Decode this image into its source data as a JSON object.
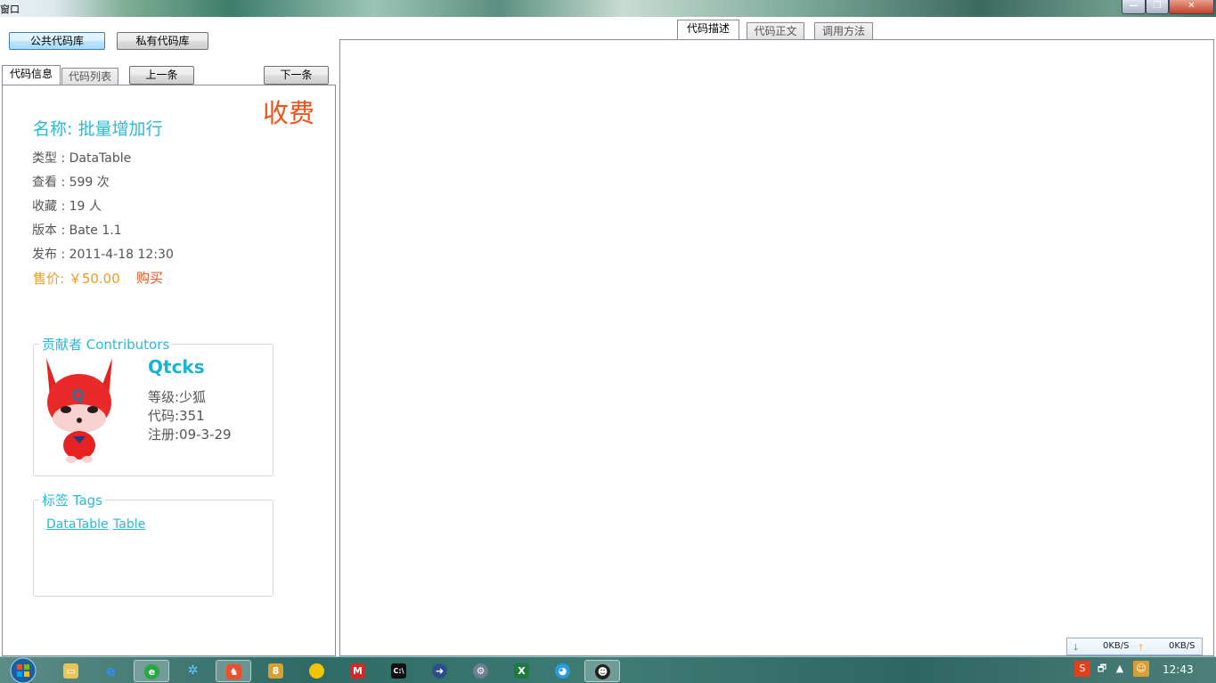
{
  "window": {
    "title": "窗口"
  },
  "top_buttons": {
    "public_lib": "公共代码库",
    "private_lib": "私有代码库"
  },
  "left_tabs": {
    "info": "代码信息",
    "list": "代码列表"
  },
  "nav": {
    "prev": "上一条",
    "next": "下一条"
  },
  "right_tabs": [
    "代码描述",
    "代码正文",
    "调用方法"
  ],
  "code": {
    "fee_label": "收费",
    "name": "名称: 批量增加行",
    "type": "类型 : DataTable",
    "views": "查看 : 599 次",
    "favorites": "收藏 : 19 人",
    "version": "版本 : Bate 1.1",
    "published": "发布 : 2011-4-18 12:30",
    "price": "售价: ￥50.00",
    "buy": "购买"
  },
  "contributors": {
    "legend": "贡献者 Contributors",
    "name": "Qtcks",
    "level": "等级:少狐",
    "code_count": "代码:351",
    "registered": "注册:09-3-29"
  },
  "tags": {
    "legend": "标签 Tags",
    "items": [
      "DataTable",
      "Table"
    ]
  },
  "netspeed": {
    "down": "0KB/S",
    "up": "0KB/S"
  },
  "taskbar": {
    "clock": "12:43",
    "apps": [
      "explorer-icon",
      "ie-icon",
      "360-browser-icon",
      "pinwheel-icon",
      "code-app-icon",
      "app-icon",
      "sun-icon",
      "m-icon",
      "cmd-icon",
      "app-icon",
      "gear-icon",
      "excel-icon",
      "bird-icon",
      "qq-icon"
    ]
  }
}
